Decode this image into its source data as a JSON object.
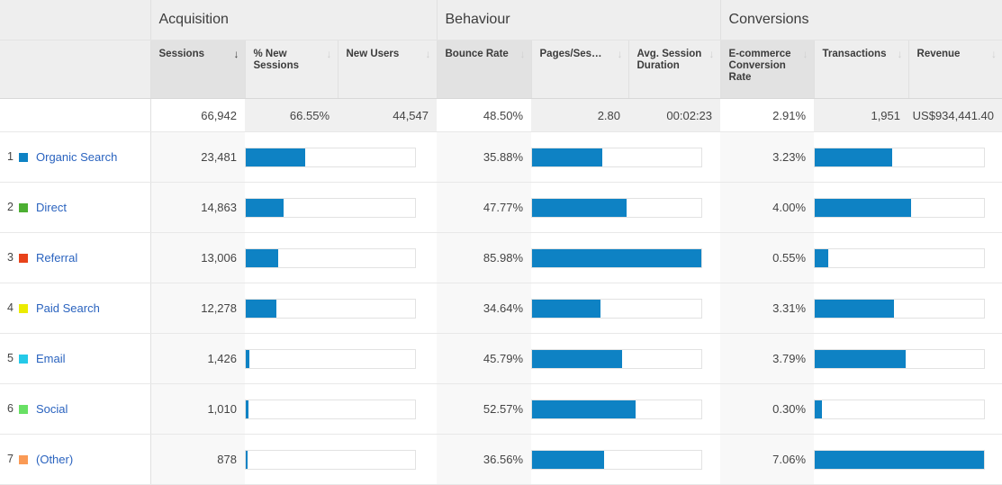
{
  "table": {
    "groups": [
      {
        "label": "",
        "span": 1
      },
      {
        "label": "Acquisition",
        "span": 3
      },
      {
        "label": "Behaviour",
        "span": 3
      },
      {
        "label": "Conversions",
        "span": 3
      }
    ],
    "columns": [
      {
        "key": "dimension",
        "label": "",
        "sorted": false,
        "arrow": ""
      },
      {
        "key": "sessions",
        "label": "Sessions",
        "sorted": true,
        "arrow": "↓"
      },
      {
        "key": "pct_new_sessions",
        "label": "% New Sessions",
        "sorted": false,
        "arrow": "↓"
      },
      {
        "key": "new_users",
        "label": "New Users",
        "sorted": false,
        "arrow": "↓"
      },
      {
        "key": "bounce_rate",
        "label": "Bounce Rate",
        "sorted": false,
        "arrow": "↓"
      },
      {
        "key": "pages_session",
        "label": "Pages/Sessi...",
        "sorted": false,
        "arrow": "↓"
      },
      {
        "key": "avg_session_duration",
        "label": "Avg. Session Duration",
        "sorted": false,
        "arrow": "↓"
      },
      {
        "key": "ecommerce_conversion_rate",
        "label": "E-commerce Conversion Rate",
        "sorted": false,
        "arrow": "↓"
      },
      {
        "key": "transactions",
        "label": "Transactions",
        "sorted": false,
        "arrow": "↓"
      },
      {
        "key": "revenue",
        "label": "Revenue",
        "sorted": false,
        "arrow": "↓"
      }
    ],
    "summary": {
      "sessions": "66,942",
      "pct_new_sessions": "66.55%",
      "new_users": "44,547",
      "bounce_rate": "48.50%",
      "pages_session": "2.80",
      "avg_session_duration": "00:02:23",
      "ecommerce_conversion_rate": "2.91%",
      "transactions": "1,951",
      "revenue": "US$934,441.40"
    },
    "rows": [
      {
        "rank": "1",
        "channel": "Organic Search",
        "color": "#0e82c4",
        "sessions": "23,481",
        "sessions_pct": 35.1,
        "bounce_rate": "35.88%",
        "bounce_pct": 41.7,
        "ecommerce_conversion_rate": "3.23%",
        "conv_pct": 45.8
      },
      {
        "rank": "2",
        "channel": "Direct",
        "color": "#4caf32",
        "sessions": "14,863",
        "sessions_pct": 22.2,
        "bounce_rate": "47.77%",
        "bounce_pct": 55.6,
        "ecommerce_conversion_rate": "4.00%",
        "conv_pct": 56.7
      },
      {
        "rank": "3",
        "channel": "Referral",
        "color": "#e8421a",
        "sessions": "13,006",
        "sessions_pct": 19.4,
        "bounce_rate": "85.98%",
        "bounce_pct": 100.0,
        "ecommerce_conversion_rate": "0.55%",
        "conv_pct": 7.8
      },
      {
        "rank": "4",
        "channel": "Paid Search",
        "color": "#ebeb00",
        "sessions": "12,278",
        "sessions_pct": 18.3,
        "bounce_rate": "34.64%",
        "bounce_pct": 40.3,
        "ecommerce_conversion_rate": "3.31%",
        "conv_pct": 46.9
      },
      {
        "rank": "5",
        "channel": "Email",
        "color": "#25c9e8",
        "sessions": "1,426",
        "sessions_pct": 2.1,
        "bounce_rate": "45.79%",
        "bounce_pct": 53.3,
        "ecommerce_conversion_rate": "3.79%",
        "conv_pct": 53.7
      },
      {
        "rank": "6",
        "channel": "Social",
        "color": "#68e064",
        "sessions": "1,010",
        "sessions_pct": 1.5,
        "bounce_rate": "52.57%",
        "bounce_pct": 61.1,
        "ecommerce_conversion_rate": "0.30%",
        "conv_pct": 4.2
      },
      {
        "rank": "7",
        "channel": "(Other)",
        "color": "#fa9a55",
        "sessions": "878",
        "sessions_pct": 1.3,
        "bounce_rate": "36.56%",
        "bounce_pct": 42.5,
        "ecommerce_conversion_rate": "7.06%",
        "conv_pct": 100.0
      }
    ]
  },
  "chart_data": {
    "type": "table",
    "title": "Channel Grouping performance",
    "categories": [
      "Organic Search",
      "Direct",
      "Referral",
      "Paid Search",
      "Email",
      "Social",
      "(Other)"
    ],
    "series": [
      {
        "name": "Sessions",
        "values": [
          23481,
          14863,
          13006,
          12278,
          1426,
          1010,
          878
        ]
      },
      {
        "name": "Bounce Rate (%)",
        "values": [
          35.88,
          47.77,
          85.98,
          34.64,
          45.79,
          52.57,
          36.56
        ]
      },
      {
        "name": "E-commerce Conversion Rate (%)",
        "values": [
          3.23,
          4.0,
          0.55,
          3.31,
          3.79,
          0.3,
          7.06
        ]
      }
    ],
    "totals": {
      "sessions": 66942,
      "pct_new_sessions": 66.55,
      "new_users": 44547,
      "bounce_rate": 48.5,
      "pages_session": 2.8,
      "avg_session_duration": "00:02:23",
      "ecommerce_conversion_rate": 2.91,
      "transactions": 1951,
      "revenue": 934441.4
    },
    "grid": false,
    "legend": "none"
  },
  "colors": {
    "bar": "#0e82c4",
    "link": "#2a63bf",
    "header_bg": "#eeeeee"
  }
}
